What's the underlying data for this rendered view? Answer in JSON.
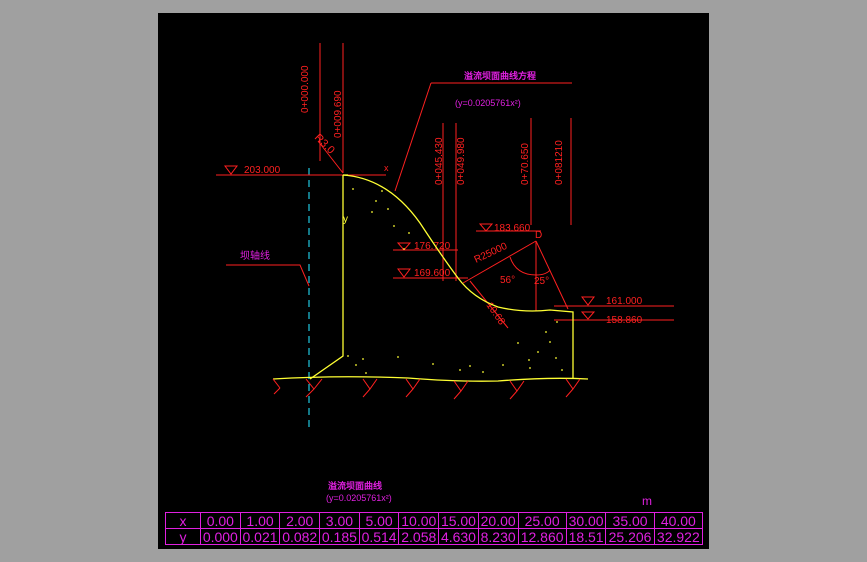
{
  "colors": {
    "background": "#000000",
    "frame": "#a0a0a0",
    "annotation_red": "#ff2020",
    "profile_yellow": "#ffff33",
    "axis_cyan": "#20c8e0",
    "table_magenta": "#e020e0"
  },
  "stations": {
    "s1": "0+000.000",
    "s2": "0+009.690",
    "s3": "0+045.430",
    "s4": "0+049.980",
    "s5": "0+70.650",
    "s6": "0+081210"
  },
  "elevations": {
    "crest": "203.000",
    "e1": "176.720",
    "e2": "169.600",
    "bucket_center": "183.660",
    "e3": "161.000",
    "e4": "158.860"
  },
  "labels": {
    "crest_radius": "R3.0",
    "curve_title": "溢流坝面曲线方程",
    "curve_equation": "(y=0.0205761x²)",
    "dam_axis": "坝轴线",
    "axis_x": "x",
    "axis_y": "y",
    "bucket_radius": "R25000",
    "bucket_point": "D",
    "angle_1": "56°",
    "angle_2": "25°",
    "tangent_length": "10.68"
  },
  "table": {
    "title": "溢流坝面曲线",
    "equation": "(y=0.0205761x²)",
    "unit": "m",
    "row_x_label": "x",
    "row_y_label": "y",
    "x_values": [
      "0.00",
      "1.00",
      "2.00",
      "3.00",
      "5.00",
      "10.00",
      "15.00",
      "20.00",
      "25.00",
      "30.00",
      "35.00",
      "40.00"
    ],
    "y_values": [
      "0.000",
      "0.021",
      "0.082",
      "0.185",
      "0.514",
      "2.058",
      "4.630",
      "8.230",
      "12.860",
      "18.51",
      "25.206",
      "32.922"
    ]
  }
}
